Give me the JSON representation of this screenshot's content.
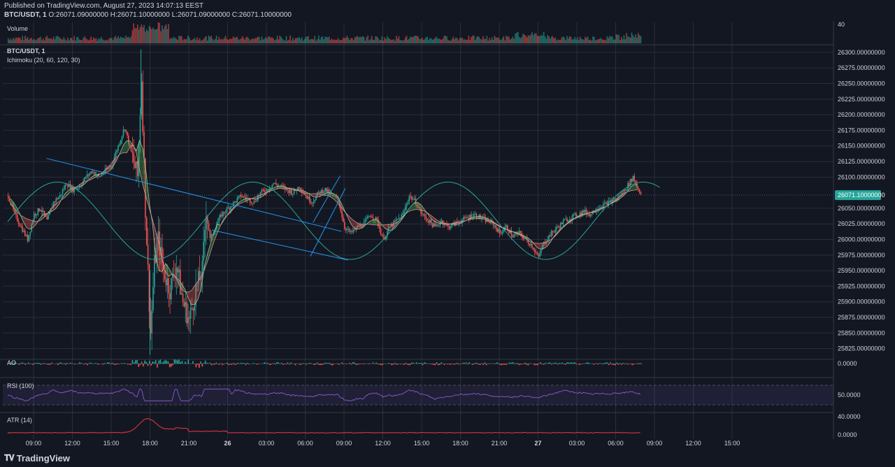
{
  "header": {
    "published": "Published on TradingView.com, August 27, 2023 14:07:13 EEST",
    "symbol_line": "BTC/USDT, 1",
    "ohlc": "O:26071.09000000 H:26071.10000000 L:26071.09000000 C:26071.10000000"
  },
  "footer": {
    "brand": "TradingView",
    "logo_icon": "tradingview-logo-icon"
  },
  "colors": {
    "background": "#131722",
    "grid": "#2a2e39",
    "up": "#26a69a",
    "down": "#ef5350",
    "trendline": "#2196f3",
    "sine": "#26a69a",
    "rsi": "#7e57c2",
    "atr": "#f23645",
    "price_label": "#26a69a"
  },
  "chart_data": [
    {
      "type": "bar",
      "panel": "volume",
      "title": "Volume",
      "ylim": [
        0,
        40
      ],
      "ticks": [
        {
          "value": 40,
          "label": "40"
        }
      ],
      "note": "dense per-minute volume histogram"
    },
    {
      "type": "candlestick",
      "panel": "price",
      "title": "BTC/USDT, 1",
      "indicator": "Ichimoku (20, 60, 120, 30)",
      "ylim": [
        25810,
        26310
      ],
      "yticks": [
        {
          "value": 26300,
          "label": "26300.00000000"
        },
        {
          "value": 26275,
          "label": "26275.00000000"
        },
        {
          "value": 26250,
          "label": "26250.00000000"
        },
        {
          "value": 26225,
          "label": "26225.00000000"
        },
        {
          "value": 26200,
          "label": "26200.00000000"
        },
        {
          "value": 26175,
          "label": "26175.00000000"
        },
        {
          "value": 26150,
          "label": "26150.00000000"
        },
        {
          "value": 26125,
          "label": "26125.00000000"
        },
        {
          "value": 26100,
          "label": "26100.00000000"
        },
        {
          "value": 26050,
          "label": "26050.00000000"
        },
        {
          "value": 26025,
          "label": "26025.00000000"
        },
        {
          "value": 26000,
          "label": "26000.00000000"
        },
        {
          "value": 25975,
          "label": "25975.00000000"
        },
        {
          "value": 25950,
          "label": "25950.00000000"
        },
        {
          "value": 25925,
          "label": "25925.00000000"
        },
        {
          "value": 25900,
          "label": "25900.00000000"
        },
        {
          "value": 25875,
          "label": "25875.00000000"
        },
        {
          "value": 25850,
          "label": "25850.00000000"
        },
        {
          "value": 25825,
          "label": "25825.00000000"
        }
      ],
      "last_price": {
        "value": 26071.1,
        "label": "26071.10000000"
      },
      "price_path_hours": [
        [
          7.0,
          26070
        ],
        [
          7.5,
          26040
        ],
        [
          8.0,
          26020
        ],
        [
          8.5,
          26000
        ],
        [
          9.0,
          26040
        ],
        [
          9.5,
          26050
        ],
        [
          10.0,
          26030
        ],
        [
          10.5,
          26060
        ],
        [
          11.0,
          26070
        ],
        [
          11.5,
          26090
        ],
        [
          12.0,
          26080
        ],
        [
          12.5,
          26085
        ],
        [
          13.0,
          26100
        ],
        [
          13.5,
          26110
        ],
        [
          14.0,
          26100
        ],
        [
          14.5,
          26110
        ],
        [
          15.0,
          26120
        ],
        [
          15.5,
          26150
        ],
        [
          16.0,
          26180
        ],
        [
          16.5,
          26140
        ],
        [
          17.0,
          26100
        ],
        [
          17.3,
          26260
        ],
        [
          17.6,
          26050
        ],
        [
          17.8,
          25950
        ],
        [
          18.0,
          25850
        ],
        [
          18.3,
          25960
        ],
        [
          18.6,
          26000
        ],
        [
          19.0,
          25950
        ],
        [
          19.5,
          25920
        ],
        [
          20.0,
          25960
        ],
        [
          20.5,
          25900
        ],
        [
          21.0,
          25870
        ],
        [
          21.5,
          25920
        ],
        [
          22.0,
          25950
        ],
        [
          22.3,
          26050
        ],
        [
          22.6,
          26000
        ],
        [
          23.0,
          26020
        ],
        [
          23.5,
          26040
        ],
        [
          24.0,
          26050
        ],
        [
          24.5,
          26060
        ],
        [
          25.0,
          26070
        ],
        [
          25.5,
          26065
        ],
        [
          26.0,
          26060
        ],
        [
          26.5,
          26075
        ],
        [
          27.0,
          26080
        ],
        [
          27.5,
          26090
        ],
        [
          28.0,
          26085
        ],
        [
          28.5,
          26080
        ],
        [
          29.0,
          26075
        ],
        [
          29.5,
          26085
        ],
        [
          30.0,
          26070
        ],
        [
          30.5,
          26060
        ],
        [
          31.0,
          26075
        ],
        [
          31.5,
          26080
        ],
        [
          32.0,
          26070
        ],
        [
          32.5,
          26065
        ],
        [
          33.0,
          26020
        ],
        [
          33.5,
          26010
        ],
        [
          34.0,
          26020
        ],
        [
          34.5,
          26025
        ],
        [
          35.0,
          26040
        ],
        [
          35.5,
          26030
        ],
        [
          36.0,
          26000
        ],
        [
          36.5,
          26020
        ],
        [
          37.0,
          26030
        ],
        [
          37.5,
          26040
        ],
        [
          38.0,
          26070
        ],
        [
          38.5,
          26060
        ],
        [
          39.0,
          26040
        ],
        [
          39.5,
          26030
        ],
        [
          40.0,
          26020
        ],
        [
          40.5,
          26030
        ],
        [
          41.0,
          26020
        ],
        [
          41.5,
          26025
        ],
        [
          42.0,
          26030
        ],
        [
          42.5,
          26035
        ],
        [
          43.0,
          26040
        ],
        [
          43.5,
          26035
        ],
        [
          44.0,
          26030
        ],
        [
          44.5,
          26025
        ],
        [
          45.0,
          26010
        ],
        [
          45.5,
          26020
        ],
        [
          46.0,
          26005
        ],
        [
          46.5,
          26010
        ],
        [
          47.0,
          26000
        ],
        [
          47.5,
          25990
        ],
        [
          48.0,
          25970
        ],
        [
          48.3,
          25990
        ],
        [
          48.6,
          26000
        ],
        [
          49.0,
          26010
        ],
        [
          49.5,
          26020
        ],
        [
          50.0,
          26030
        ],
        [
          50.5,
          26035
        ],
        [
          51.0,
          26040
        ],
        [
          51.5,
          26045
        ],
        [
          52.0,
          26040
        ],
        [
          52.5,
          26050
        ],
        [
          53.0,
          26055
        ],
        [
          53.5,
          26060
        ],
        [
          54.0,
          26065
        ],
        [
          54.5,
          26075
        ],
        [
          55.0,
          26090
        ],
        [
          55.3,
          26100
        ],
        [
          55.6,
          26085
        ],
        [
          56.0,
          26071
        ]
      ],
      "trendlines": [
        {
          "name": "upper-channel-line",
          "x": [
            10.0,
            32.8
          ],
          "y": [
            26130,
            26013
          ]
        },
        {
          "name": "lower-channel-line",
          "x": [
            22.8,
            33.3
          ],
          "y": [
            26015,
            25967
          ]
        },
        {
          "name": "rising-upper-line",
          "x": [
            30.6,
            32.7
          ],
          "y": [
            26027,
            26102
          ]
        },
        {
          "name": "rising-lower-line",
          "x": [
            30.4,
            33.1
          ],
          "y": [
            25973,
            26082
          ]
        }
      ]
    },
    {
      "type": "bar",
      "panel": "oscillator",
      "title": "AO",
      "ticks": [
        {
          "value": 0,
          "label": "0.0000"
        }
      ]
    },
    {
      "type": "line",
      "panel": "rsi",
      "title": "RSI (100)",
      "ylim": [
        35,
        65
      ],
      "band": [
        40,
        60
      ],
      "ticks": [
        {
          "value": 50,
          "label": "50.0000"
        }
      ]
    },
    {
      "type": "line",
      "panel": "atr",
      "title": "ATR (14)",
      "ylim": [
        0,
        40
      ],
      "ticks": [
        {
          "value": 40,
          "label": "40.0000"
        },
        {
          "value": 0,
          "label": "0.0000"
        }
      ]
    },
    {
      "type": "axis",
      "panel": "time",
      "xticks": [
        {
          "hour": 9,
          "label": "09:00",
          "bold": false
        },
        {
          "hour": 12,
          "label": "12:00",
          "bold": false
        },
        {
          "hour": 15,
          "label": "15:00",
          "bold": false
        },
        {
          "hour": 18,
          "label": "18:00",
          "bold": false
        },
        {
          "hour": 21,
          "label": "21:00",
          "bold": false
        },
        {
          "hour": 24,
          "label": "26",
          "bold": true
        },
        {
          "hour": 27,
          "label": "03:00",
          "bold": false
        },
        {
          "hour": 30,
          "label": "06:00",
          "bold": false
        },
        {
          "hour": 33,
          "label": "09:00",
          "bold": false
        },
        {
          "hour": 36,
          "label": "12:00",
          "bold": false
        },
        {
          "hour": 39,
          "label": "15:00",
          "bold": false
        },
        {
          "hour": 42,
          "label": "18:00",
          "bold": false
        },
        {
          "hour": 45,
          "label": "21:00",
          "bold": false
        },
        {
          "hour": 48,
          "label": "27",
          "bold": true
        },
        {
          "hour": 51,
          "label": "03:00",
          "bold": false
        },
        {
          "hour": 54,
          "label": "06:00",
          "bold": false
        },
        {
          "hour": 57,
          "label": "09:00",
          "bold": false
        },
        {
          "hour": 60,
          "label": "12:00",
          "bold": false
        },
        {
          "hour": 63,
          "label": "15:00",
          "bold": false
        }
      ]
    }
  ]
}
